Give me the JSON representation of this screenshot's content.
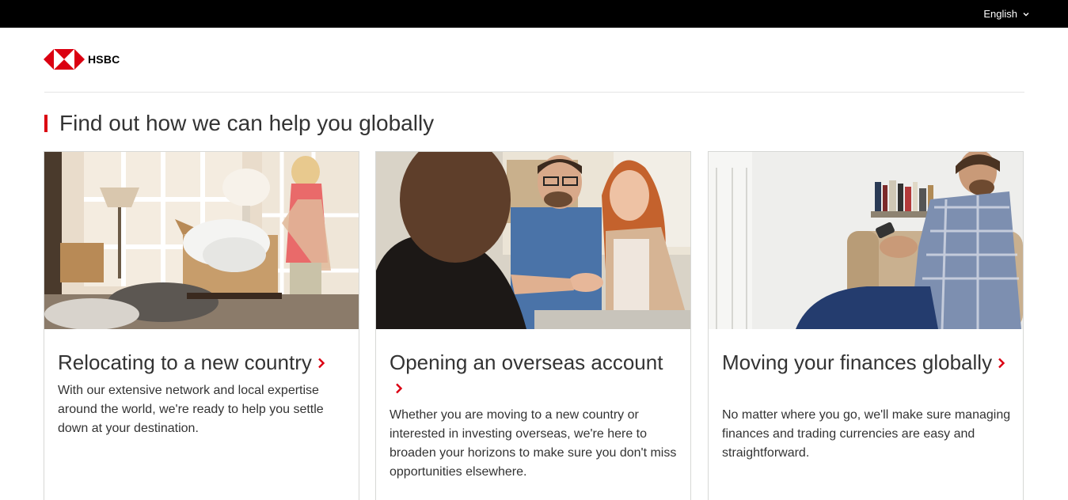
{
  "topbar": {
    "language_label": "English"
  },
  "header": {
    "logo_text": "HSBC"
  },
  "section": {
    "heading": "Find out how we can help you globally"
  },
  "cards": [
    {
      "title": "Relocating to a new country",
      "description": "With our extensive network and local expertise around the world, we're ready to help you settle down at your destination.",
      "image": "woman-unpacking-boxes-photo"
    },
    {
      "title": "Opening an overseas account",
      "description": "Whether you are moving to a new country or interested in investing overseas, we're here to broaden your horizons to make sure you don't miss opportunities elsewhere.",
      "image": "couple-handshake-photo"
    },
    {
      "title": "Moving your finances globally",
      "description": "No matter where you go, we'll make sure managing finances and trading currencies are easy and straightforward.",
      "image": "man-on-sofa-phone-photo"
    }
  ],
  "colors": {
    "brand_red": "#db0011",
    "topbar": "#000000",
    "text": "#333333",
    "border": "#d7d8d6"
  },
  "icons": {
    "language_dropdown": "chevron-down-icon",
    "card_link": "chevron-right-icon",
    "logo": "hsbc-hexagon-logo"
  }
}
